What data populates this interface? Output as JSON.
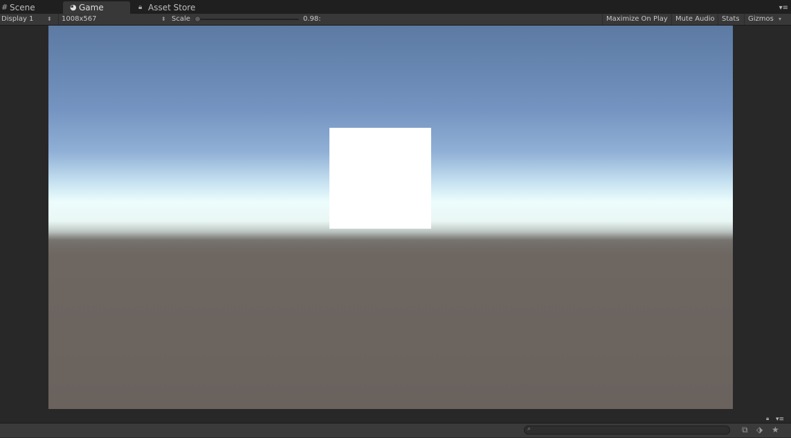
{
  "tabs": {
    "scene": {
      "label": "Scene",
      "icon": "grid-icon"
    },
    "game": {
      "label": "Game",
      "icon": "pacman-icon"
    },
    "asset_store": {
      "label": "Asset Store",
      "icon": "lock-icon"
    }
  },
  "toolbar": {
    "display": "Display 1",
    "resolution": "1008x567",
    "scale_label": "Scale",
    "scale_value": "0.98:",
    "scale_fraction": 0.0,
    "maximize_on_play": "Maximize On Play",
    "mute_audio": "Mute Audio",
    "stats": "Stats",
    "gizmos": "Gizmos"
  },
  "viewport": {
    "sky_color_top": "#5c7aa2",
    "horizon_color": "#edfdfd",
    "ground_color": "#6a625d",
    "object_color": "#ffffff"
  },
  "bottom": {
    "search_placeholder": "",
    "icons": [
      "lock-icon",
      "menu-icon",
      "search-icon",
      "filter-by-type-icon",
      "filter-by-label-icon",
      "favorites-icon"
    ]
  }
}
